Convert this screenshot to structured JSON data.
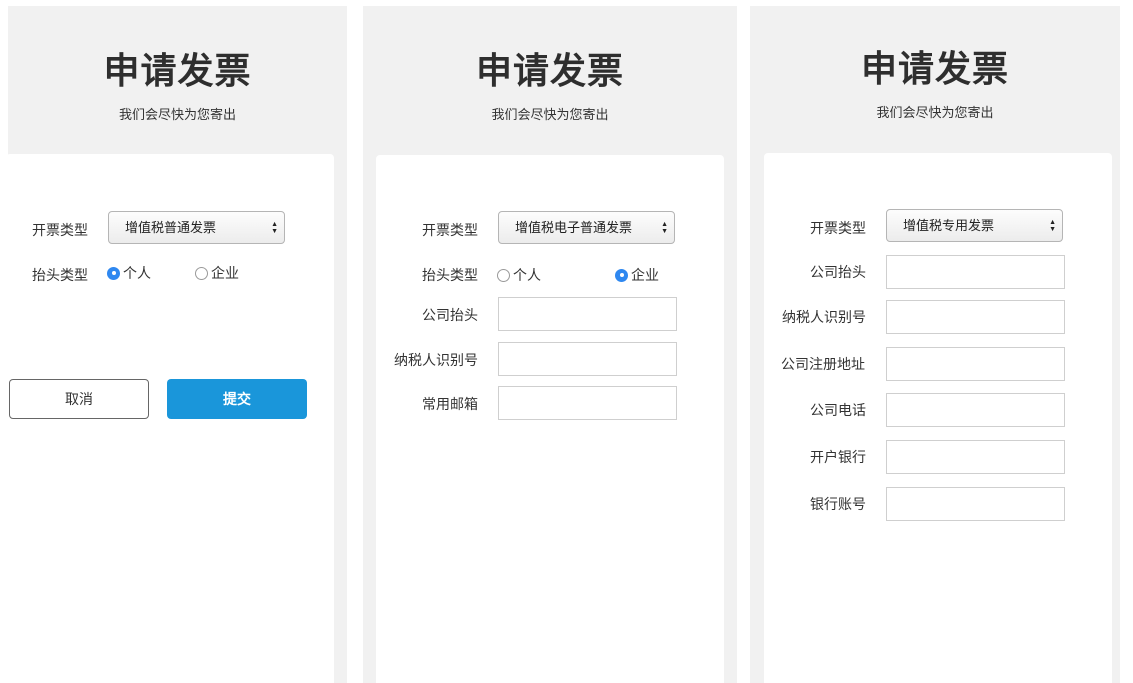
{
  "panels": [
    {
      "title": "申请发票",
      "subtitle": "我们会尽快为您寄出",
      "invoice_type_label": "开票类型",
      "invoice_type_value": "增值税普通发票",
      "header_type_label": "抬头类型",
      "radio_personal": "个人",
      "radio_company": "企业",
      "selected": "个人",
      "cancel_label": "取消",
      "submit_label": "提交"
    },
    {
      "title": "申请发票",
      "subtitle": "我们会尽快为您寄出",
      "invoice_type_label": "开票类型",
      "invoice_type_value": "增值税电子普通发票",
      "header_type_label": "抬头类型",
      "radio_personal": "个人",
      "radio_company": "企业",
      "selected": "企业",
      "fields": [
        "公司抬头",
        "纳税人识别号",
        "常用邮箱"
      ]
    },
    {
      "title": "申请发票",
      "subtitle": "我们会尽快为您寄出",
      "invoice_type_label": "开票类型",
      "invoice_type_value": "增值税专用发票",
      "fields": [
        "公司抬头",
        "纳税人识别号",
        "公司注册地址",
        "公司电话",
        "开户银行",
        "银行账号"
      ]
    }
  ],
  "colors": {
    "accent": "#1a96da",
    "radio_checked": "#2f88f0",
    "panel_bg": "#f1f1f1"
  }
}
